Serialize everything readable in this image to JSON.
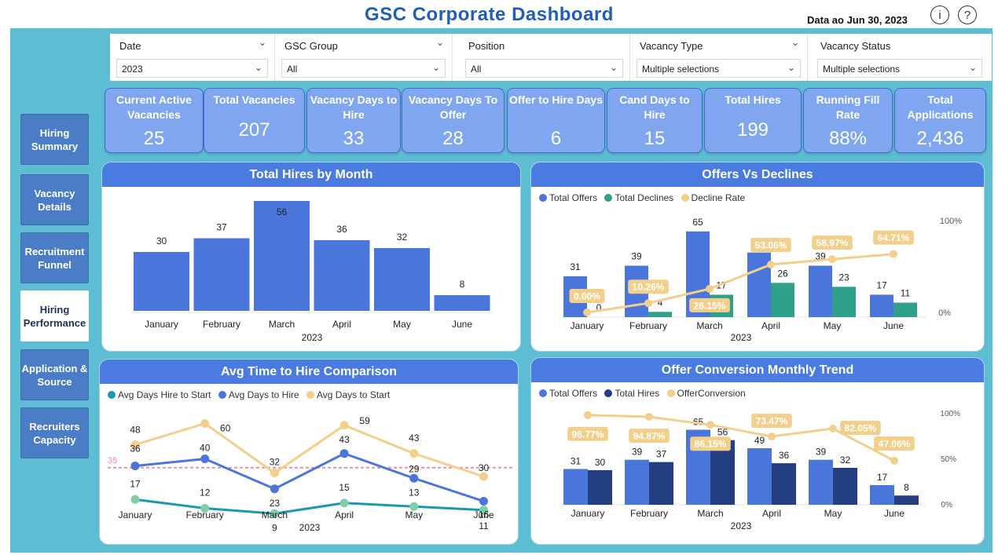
{
  "header": {
    "title": "GSC Corporate Dashboard",
    "as_of": "Data ao Jun 30, 2023",
    "info_icon": "info-icon",
    "help_icon": "help-icon"
  },
  "slicers": [
    {
      "label": "Date",
      "value": "2023"
    },
    {
      "label": "GSC Group",
      "value": "All"
    },
    {
      "label": "Position",
      "value": "All"
    },
    {
      "label": "Vacancy Type",
      "value": "Multiple selections"
    },
    {
      "label": "Vacancy Status",
      "value": "Multiple selections"
    }
  ],
  "nav": [
    {
      "label": "Hiring Summary",
      "active": false
    },
    {
      "label": "Vacancy Details",
      "active": false
    },
    {
      "label": "Recruitment Funnel",
      "active": false
    },
    {
      "label": "Hiring Performance",
      "active": true
    },
    {
      "label": "Application & Source",
      "active": false
    },
    {
      "label": "Recruiters Capacity",
      "active": false
    }
  ],
  "kpis": [
    {
      "label": "Current Active Vacancies",
      "value": "25"
    },
    {
      "label": "Total Vacancies",
      "value": "207"
    },
    {
      "label": "Vacancy Days to Hire",
      "value": "33"
    },
    {
      "label": "Vacancy Days To Offer",
      "value": "28"
    },
    {
      "label": "Offer to Hire Days",
      "value": "6"
    },
    {
      "label": "Cand Days to Hire",
      "value": "15"
    },
    {
      "label": "Total Hires",
      "value": "199"
    },
    {
      "label": "Running Fill Rate",
      "value": "88%"
    },
    {
      "label": "Total Applications",
      "value": "2,436"
    }
  ],
  "colors": {
    "accent": "#4a7be1",
    "bar_blue": "#4a76dc",
    "teal": "#2fa08a",
    "gold": "#f2cf8a",
    "navy": "#243e82",
    "ref_line": "#ee8fa2",
    "green": "#7fcfa5",
    "teal_line": "#1b98b0"
  },
  "chart_data": [
    {
      "type": "bar",
      "title": "Total Hires by Month",
      "categories": [
        "January",
        "February",
        "March",
        "April",
        "May",
        "June"
      ],
      "xgroup": "2023",
      "series": [
        {
          "values": [
            30,
            37,
            56,
            36,
            32,
            8
          ]
        }
      ]
    },
    {
      "type": "bar",
      "title": "Offers Vs Declines",
      "categories": [
        "January",
        "February",
        "March",
        "April",
        "May",
        "June"
      ],
      "xgroup": "2023",
      "series": [
        {
          "name": "Total Offers",
          "values": [
            31,
            39,
            65,
            49,
            39,
            17
          ]
        },
        {
          "name": "Total Declines",
          "values": [
            0,
            4,
            17,
            26,
            23,
            11
          ]
        },
        {
          "name": "Decline Rate",
          "values": [
            0.0,
            10.26,
            26.15,
            53.06,
            58.97,
            64.71
          ],
          "labels": [
            "0.00%",
            "10.26%",
            "26.15%",
            "53.06%",
            "58.97%",
            "64.71%"
          ]
        }
      ],
      "y2_ticks": [
        "100%",
        "0%"
      ]
    },
    {
      "type": "line",
      "title": "Avg Time to Hire Comparison",
      "categories": [
        "January",
        "February",
        "March",
        "April",
        "May",
        "June"
      ],
      "xgroup": "2023",
      "reference_line": {
        "value": 35,
        "label": "35"
      },
      "series": [
        {
          "name": "Avg Days Hire to Start",
          "values": [
            17,
            12,
            9,
            15,
            13,
            11
          ]
        },
        {
          "name": "Avg Days to Hire",
          "values": [
            36,
            40,
            23,
            43,
            29,
            16
          ]
        },
        {
          "name": "Avg Days to Start",
          "values": [
            48,
            60,
            32,
            59,
            43,
            30
          ]
        }
      ]
    },
    {
      "type": "bar",
      "title": "Offer Conversion Monthly Trend",
      "categories": [
        "January",
        "February",
        "March",
        "April",
        "May",
        "June"
      ],
      "xgroup": "2023",
      "series": [
        {
          "name": "Total Offers",
          "values": [
            31,
            39,
            65,
            49,
            39,
            17
          ]
        },
        {
          "name": "Total Hires",
          "values": [
            30,
            37,
            56,
            36,
            32,
            8
          ]
        },
        {
          "name": "OfferConversion",
          "values": [
            96.77,
            94.87,
            86.15,
            73.47,
            82.05,
            47.06
          ],
          "labels": [
            "96.77%",
            "94.87%",
            "86.15%",
            "73.47%",
            "82.05%",
            "47.06%"
          ]
        }
      ],
      "y2_ticks": [
        "100%",
        "50%",
        "0%"
      ]
    }
  ]
}
